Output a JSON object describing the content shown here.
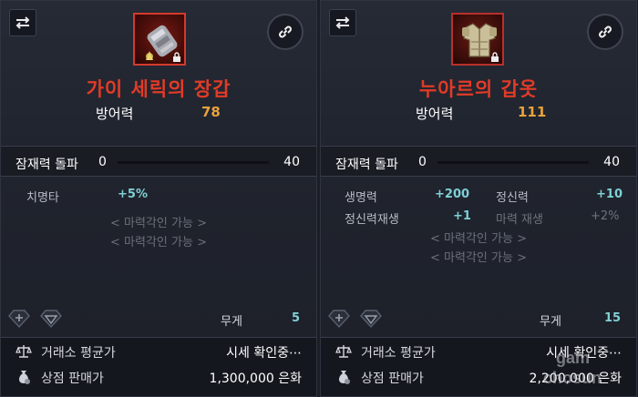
{
  "left": {
    "item_name": "가이 세릭의 장갑",
    "main_stat_label": "방어력",
    "main_stat_value": "78",
    "breakthrough_label": "잠재력 돌파",
    "breakthrough_min": "0",
    "breakthrough_max": "40",
    "substats": [
      {
        "label": "치명타",
        "value": "+5%"
      }
    ],
    "engrave_slots": [
      "< 마력각인 가능 >",
      "< 마력각인 가능 >"
    ],
    "weight_label": "무게",
    "weight_value": "5",
    "market_label": "거래소 평균가",
    "market_value": "시세 확인중⋯",
    "shop_label": "상점 판매가",
    "shop_value": "1,300,000 은화"
  },
  "right": {
    "item_name": "누아르의 갑옷",
    "main_stat_label": "방어력",
    "main_stat_value": "111",
    "breakthrough_label": "잠재력 돌파",
    "breakthrough_min": "0",
    "breakthrough_max": "40",
    "substats": [
      {
        "label": "생명력",
        "value": "+200"
      },
      {
        "label": "정신력",
        "value": "+10"
      },
      {
        "label": "정신력재생",
        "value": "+1"
      },
      {
        "label": "마력 재생",
        "value": "+2%"
      }
    ],
    "engrave_slots": [
      "< 마력각인 가능 >",
      "< 마력각인 가능 >"
    ],
    "weight_label": "무게",
    "weight_value": "15",
    "market_label": "거래소 평균가",
    "market_value": "시세 확인중⋯",
    "shop_label": "상점 판매가",
    "shop_value": "2,200,000 은화"
  },
  "icons": {
    "swap": "swap-arrows-icon",
    "link": "chain-link-icon",
    "slot": "gem-slot-icon",
    "market": "scales-icon",
    "shop": "money-bag-icon",
    "lock": "lock-icon"
  },
  "colors": {
    "item_name": "#e23b27",
    "main_stat_value": "#e9a23c",
    "substat_value": "#7fd0d6",
    "panel_bg": "#20242e"
  },
  "watermark": {
    "line1": "gam",
    "line2": "chosun"
  }
}
